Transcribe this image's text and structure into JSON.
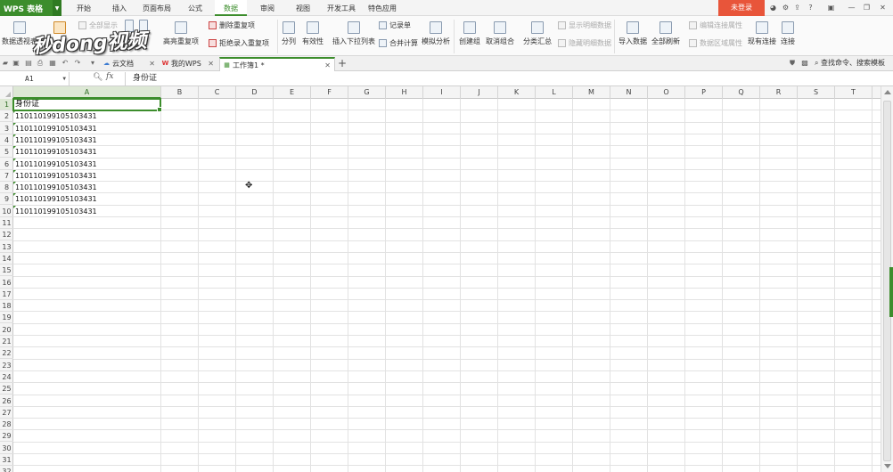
{
  "app": {
    "name": "WPS 表格",
    "login": "未登录"
  },
  "menu": {
    "tabs": [
      "开始",
      "插入",
      "页面布局",
      "公式",
      "数据",
      "审阅",
      "视图",
      "开发工具",
      "特色应用"
    ],
    "active": "数据"
  },
  "ribbon": {
    "pivot": "数据透视表",
    "filter_show_all": "全部显示",
    "highlight_dup": "高亮重复项",
    "delete_dup": "删除重复项",
    "reject_dup": "拒绝录入重复项",
    "split": "分列",
    "validity": "有效性",
    "insert_dropdown": "插入下拉列表",
    "record_form": "记录单",
    "merge_calc": "合并计算",
    "simulate": "模拟分析",
    "create_group": "创建组",
    "ungroup": "取消组合",
    "subtotal": "分类汇总",
    "show_detail": "显示明细数据",
    "hide_detail": "隐藏明细数据",
    "import_data": "导入数据",
    "refresh_all": "全部刷新",
    "edit_conn_props": "编辑连接属性",
    "range_props": "数据区域属性",
    "existing_conn": "现有连接",
    "connect": "连接"
  },
  "watermark": "秒dong视频",
  "doc_tabs": [
    {
      "label": "云文档",
      "icon": "cloud-icon"
    },
    {
      "label": "我的WPS",
      "icon": "wps-logo-icon"
    },
    {
      "label": "工作簿1 *",
      "icon": "sheet-icon",
      "active": true
    }
  ],
  "search_command": "查找命令、搜索模板",
  "formula_bar": {
    "name_box": "A1",
    "fx": "fx",
    "content": "身份证"
  },
  "columns": [
    "A",
    "B",
    "C",
    "D",
    "E",
    "F",
    "G",
    "H",
    "I",
    "J",
    "K",
    "L",
    "M",
    "N",
    "O",
    "P",
    "Q",
    "R",
    "S",
    "T"
  ],
  "rows": [
    "1",
    "2",
    "3",
    "4",
    "5",
    "6",
    "7",
    "8",
    "9",
    "10",
    "11",
    "12",
    "13",
    "14",
    "15",
    "16",
    "17",
    "18",
    "19",
    "20",
    "21",
    "22",
    "23",
    "24",
    "25",
    "26",
    "27",
    "28",
    "29",
    "30",
    "31",
    "32"
  ],
  "cells": {
    "A1": "身份证",
    "A_values": [
      "110110199105103431",
      "110110199105103431",
      "110110199105103431",
      "110110199105103431",
      "110110199105103431",
      "110110199105103431",
      "110110199105103431",
      "110110199105103431",
      "110110199105103431"
    ]
  },
  "colors": {
    "accent": "#3c8d2c",
    "login_bg": "#e8553a"
  }
}
